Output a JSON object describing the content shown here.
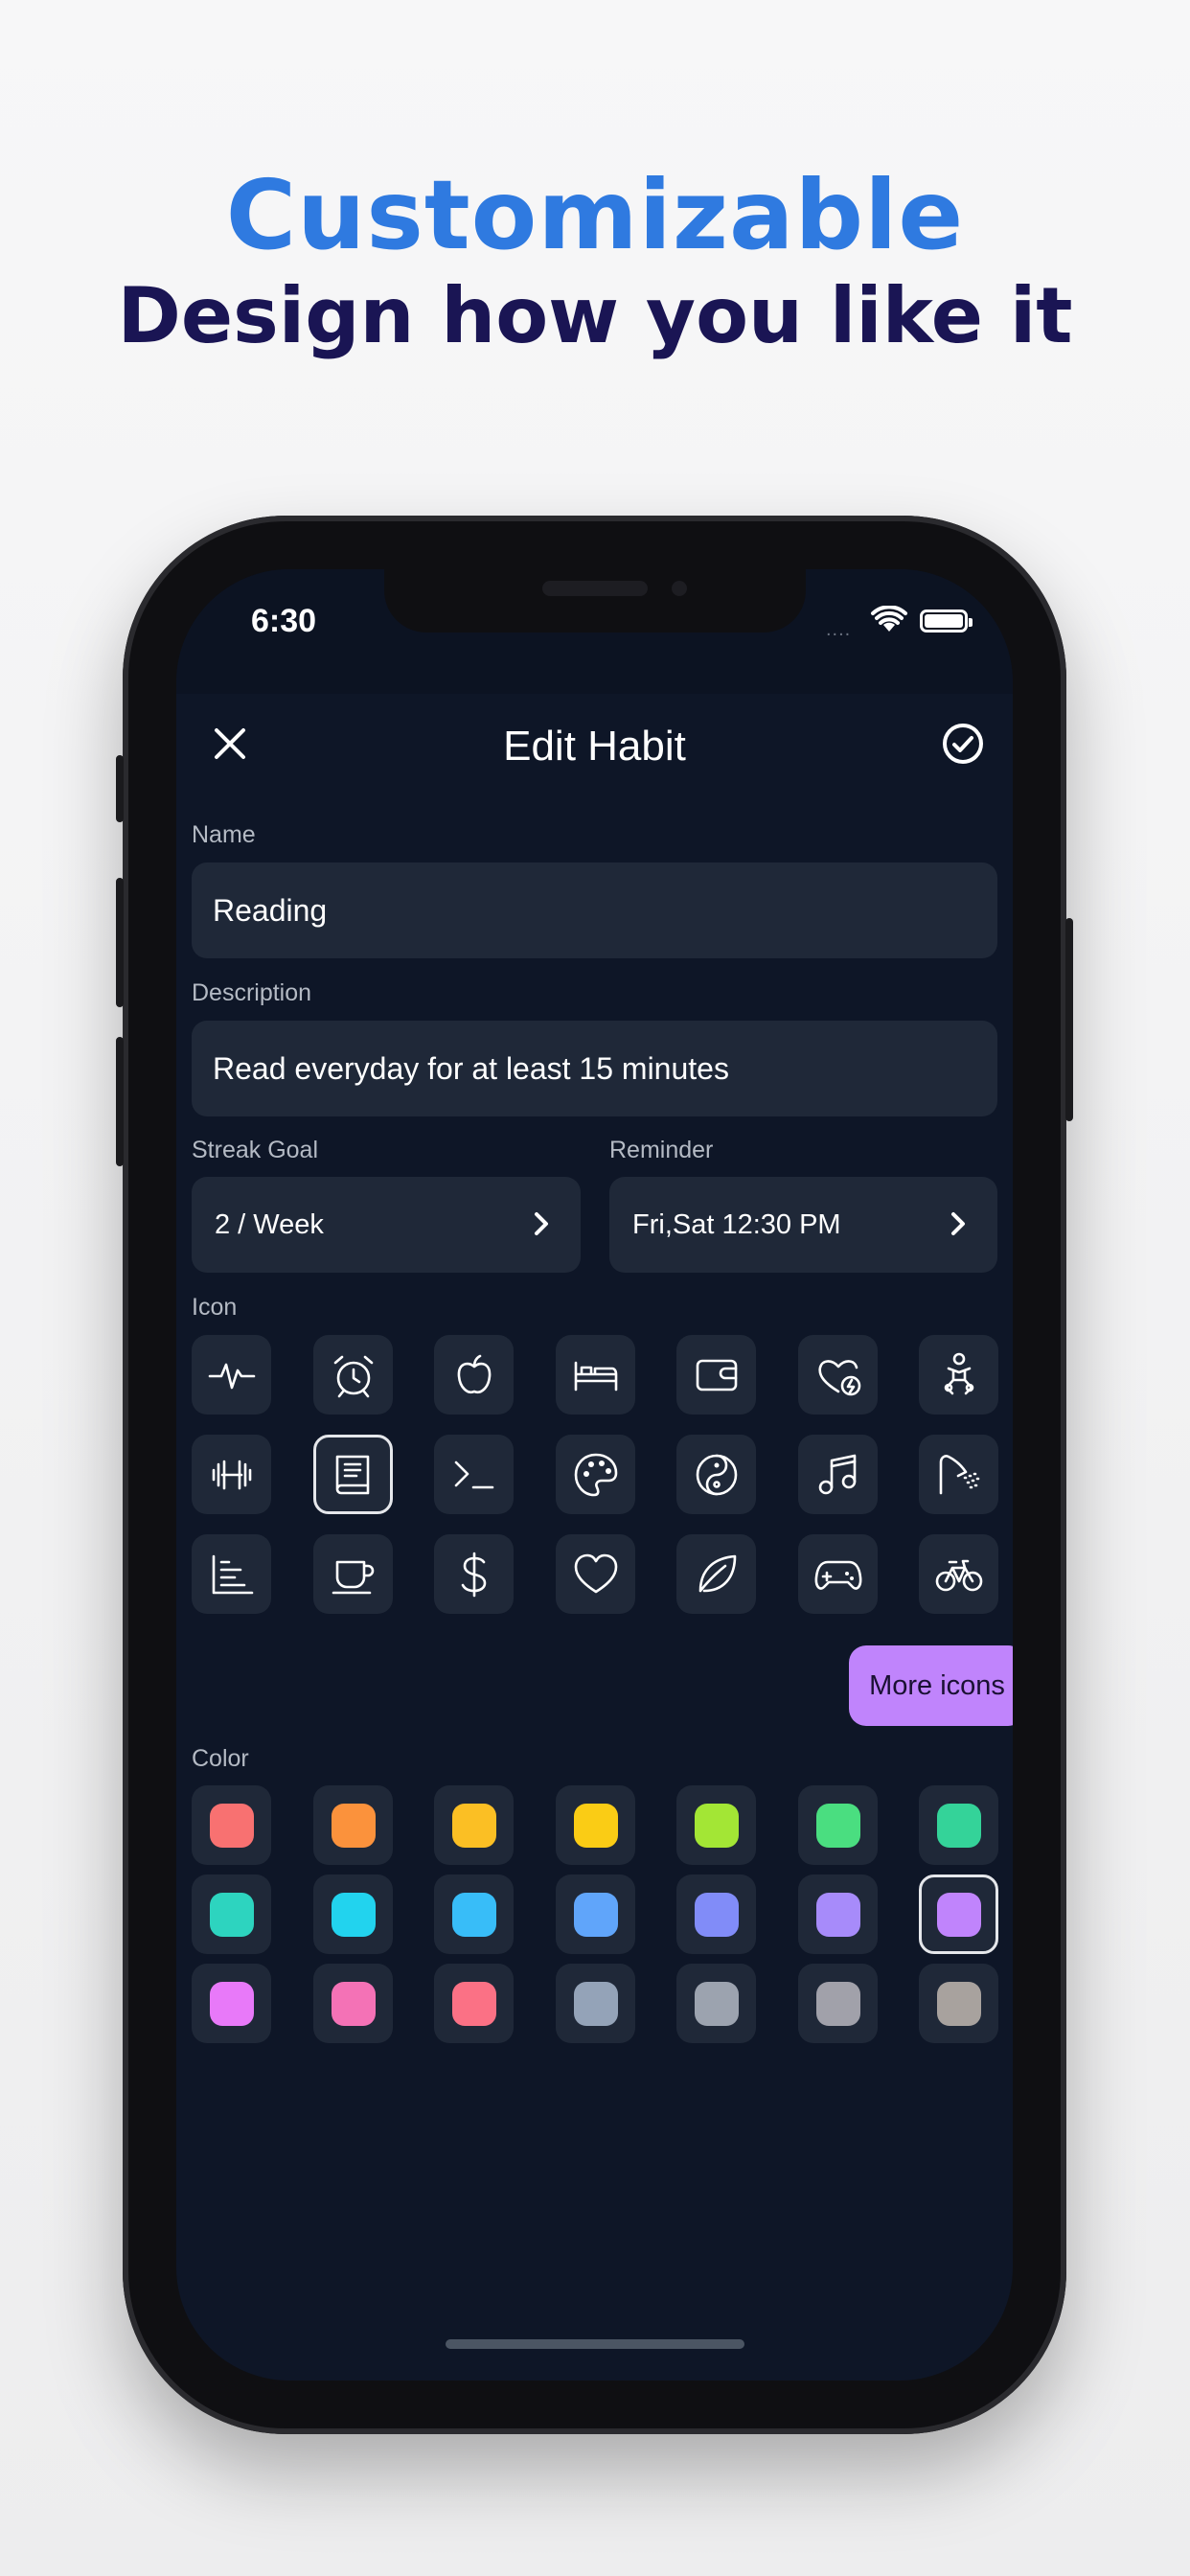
{
  "headline": {
    "title": "Customizable",
    "subtitle": "Design how you like it"
  },
  "status_bar": {
    "time": "6:30",
    "signal": "....",
    "icons": [
      "wifi-icon",
      "battery-icon"
    ]
  },
  "appbar": {
    "title": "Edit Habit",
    "close_icon": "close-icon",
    "save_icon": "check-circle-icon"
  },
  "form": {
    "name_label": "Name",
    "name_value": "Reading",
    "description_label": "Description",
    "description_value": "Read everyday for at least 15 minutes",
    "streak_label": "Streak Goal",
    "streak_value": "2 / Week",
    "reminder_label": "Reminder",
    "reminder_value": "Fri,Sat 12:30 PM",
    "icon_label": "Icon",
    "color_label": "Color",
    "more_icons_label": "More icons"
  },
  "icons": [
    "pulse-icon",
    "alarm-clock-icon",
    "apple-icon",
    "bed-icon",
    "wallet-icon",
    "heart-bolt-icon",
    "baby-icon",
    "dumbbell-icon",
    "book-icon",
    "terminal-icon",
    "palette-icon",
    "yin-yang-icon",
    "music-note-icon",
    "shower-icon",
    "bar-chart-icon",
    "coffee-cup-icon",
    "dollar-icon",
    "heart-icon",
    "leaf-icon",
    "gamepad-icon",
    "bicycle-icon"
  ],
  "selected_icon": "book-icon",
  "colors": [
    "#f87171",
    "#fb923c",
    "#fbbf24",
    "#facc15",
    "#a3e635",
    "#4ade80",
    "#34d399",
    "#2dd4bf",
    "#22d3ee",
    "#38bdf8",
    "#60a5fa",
    "#818cf8",
    "#a78bfa",
    "#c084fc",
    "#e879f9",
    "#f472b6",
    "#fb7185",
    "#94a3b8",
    "#9ca3af",
    "#a1a1aa",
    "#a8a29e"
  ],
  "selected_color": "#c084fc"
}
